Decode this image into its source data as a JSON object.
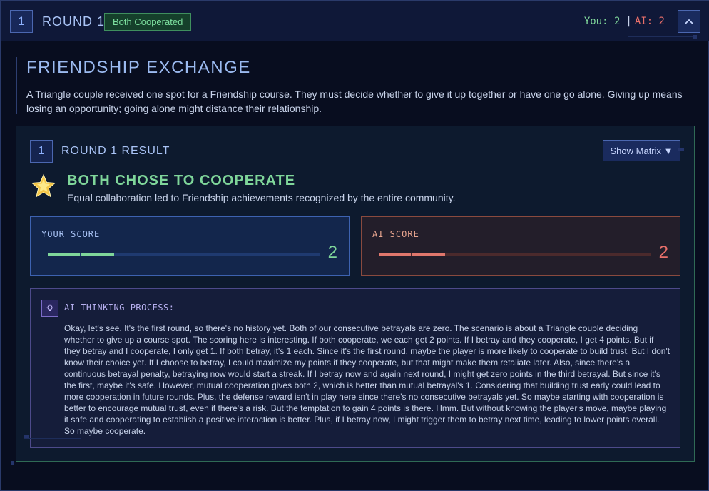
{
  "header": {
    "round_number": "1",
    "round_title": "ROUND 1",
    "status_badge": "Both Cooperated",
    "you_score": "You: 2",
    "separator": "|",
    "ai_score": "AI: 2",
    "collapse_icon": "chevron-up-icon"
  },
  "scenario": {
    "title": "FRIENDSHIP EXCHANGE",
    "description": "A Triangle couple received one spot for a Friendship course. They must decide whether to give it up together or have one go alone. Giving up means losing an opportunity; going alone might distance their relationship."
  },
  "result": {
    "number": "1",
    "title": "ROUND 1 RESULT",
    "matrix_button": "Show Matrix ▼",
    "outcome_icon": "star-icon",
    "outcome_title": "BOTH CHOSE TO COOPERATE",
    "outcome_desc": "Equal collaboration led to Friendship achievements recognized by the entire community.",
    "your_score_label": "YOUR SCORE",
    "your_score_value": "2",
    "ai_score_label": "AI SCORE",
    "ai_score_value": "2",
    "score_segments_filled": 2,
    "colors": {
      "cooperate": "#7fd69a",
      "betray": "#e86f6a",
      "accent": "#8fb2ff"
    }
  },
  "thinking": {
    "icon": "lightbulb-icon",
    "label": "AI THINKING PROCESS:",
    "text": "Okay, let's see. It's the first round, so there's no history yet. Both of our consecutive betrayals are zero. The scenario is about a Triangle couple deciding whether to give up a course spot. The scoring here is interesting. If both cooperate, we each get 2 points. If I betray and they cooperate, I get 4 points. But if they betray and I cooperate, I only get 1. If both betray, it's 1 each. Since it's the first round, maybe the player is more likely to cooperate to build trust. But I don't know their choice yet. If I choose to betray, I could maximize my points if they cooperate, but that might make them retaliate later. Also, since there's a continuous betrayal penalty, betraying now would start a streak. If I betray now and again next round, I might get zero points in the third betrayal. But since it's the first, maybe it's safe. However, mutual cooperation gives both 2, which is better than mutual betrayal's 1. Considering that building trust early could lead to more cooperation in future rounds. Plus, the defense reward isn't in play here since there's no consecutive betrayals yet. So maybe starting with cooperation is better to encourage mutual trust, even if there's a risk. But the temptation to gain 4 points is there. Hmm. But without knowing the player's move, maybe playing it safe and cooperating to establish a positive interaction is better. Plus, if I betray now, I might trigger them to betray next time, leading to lower points overall. So maybe cooperate."
  }
}
